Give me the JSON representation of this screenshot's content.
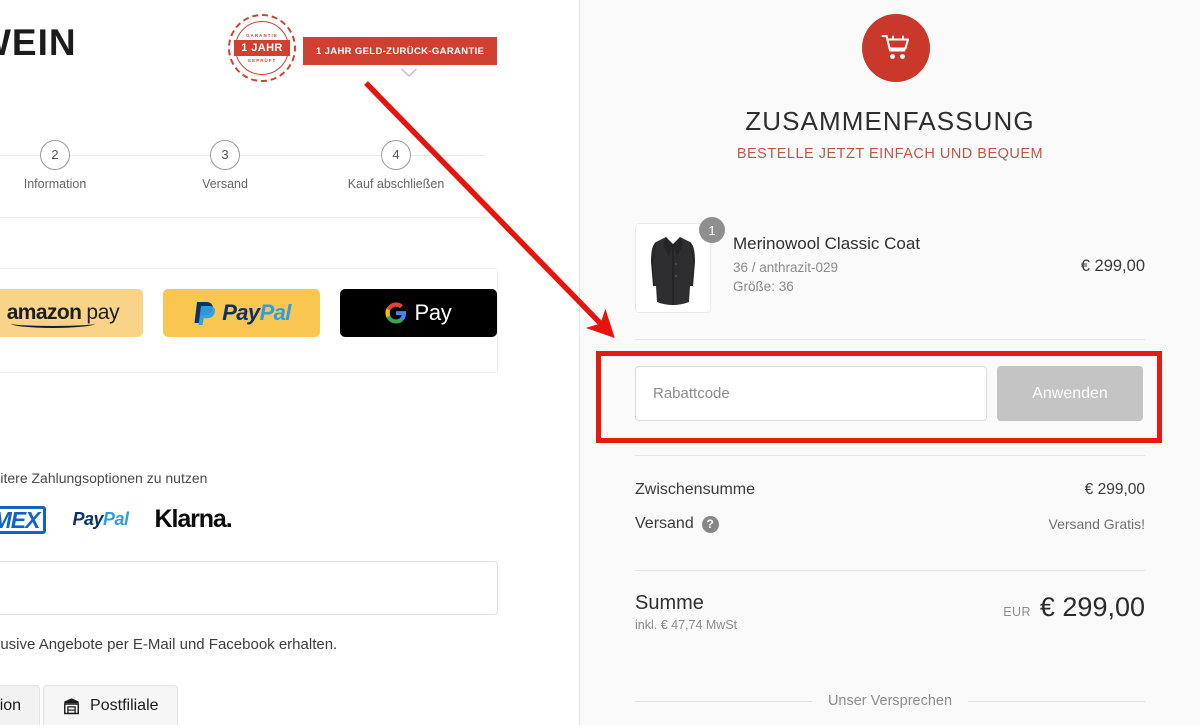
{
  "colors": {
    "brand_red": "#cf4030",
    "cart_red": "#c9382b",
    "annotation_red": "#e51a10",
    "panel_bg": "#fafafa",
    "apply_gray": "#c4c4c4"
  },
  "left": {
    "logo": "WEIN",
    "guarantee": {
      "stamp_top": "GARANTIE",
      "stamp_band": "1 JAHR",
      "stamp_bottom": "GEPRÜFT",
      "bar_label": "1 JAHR GELD-ZURÜCK-GARANTIE",
      "chevron": "chevron-down-icon"
    },
    "steps": [
      {
        "number": "2",
        "label": "Information"
      },
      {
        "number": "3",
        "label": "Versand"
      },
      {
        "number": "4",
        "label": "Kauf abschließen"
      }
    ],
    "express_payments": [
      {
        "name": "amazon-pay",
        "text_bold": "amazon",
        "text_light": "pay"
      },
      {
        "name": "paypal",
        "text_a": "Pay",
        "text_b": "Pal"
      },
      {
        "name": "google-pay",
        "text": "Pay"
      }
    ],
    "more_payments_text": "ben, um weitere Zahlungsoptionen zu nutzen",
    "payment_logos": [
      {
        "name": "amex",
        "label": "AMEX"
      },
      {
        "name": "paypal",
        "label_a": "Pay",
        "label_b": "Pal"
      },
      {
        "name": "klarna",
        "label": "Klarna."
      }
    ],
    "newsletter_text": "xklusive Angebote per E-Mail und Facebook erhalten.",
    "shipping_tabs": [
      {
        "label": "ackstation",
        "icon": "",
        "active": false
      },
      {
        "label": "Postfiliale",
        "icon": "post-office-icon",
        "active": true
      }
    ]
  },
  "right": {
    "cart_icon": "shopping-cart-icon",
    "title": "ZUSAMMENFASSUNG",
    "subtitle": "BESTELLE JETZT EINFACH UND BEQUEM",
    "product": {
      "name": "Merinowool Classic Coat",
      "variant": "36 / anthrazit-029",
      "size_line": "Größe: 36",
      "quantity": "1",
      "price": "€ 299,00",
      "thumb_alt": "coat-thumbnail"
    },
    "discount": {
      "placeholder": "Rabattcode",
      "value": "",
      "apply_label": "Anwenden"
    },
    "totals": [
      {
        "label": "Zwischensumme",
        "value": "€ 299,00",
        "muted": false,
        "has_help": false
      },
      {
        "label": "Versand",
        "value": "Versand Gratis!",
        "muted": true,
        "has_help": true
      }
    ],
    "grand_total": {
      "label": "Summe",
      "sub": "inkl. € 47,74 MwSt",
      "currency": "EUR",
      "amount": "€ 299,00"
    },
    "promise_label": "Unser Versprechen"
  },
  "annotation": {
    "arrow": "red-arrow-annotation",
    "highlight_box": "red-highlight-box-discount"
  }
}
